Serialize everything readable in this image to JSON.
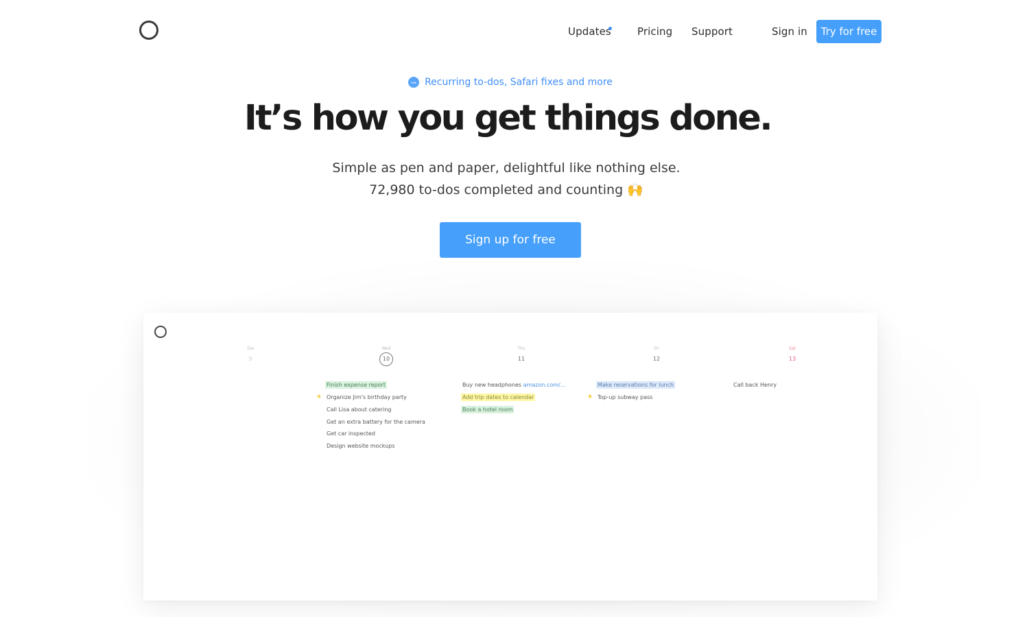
{
  "nav": {
    "updates": "Updates",
    "pricing": "Pricing",
    "support": "Support",
    "sign_in": "Sign in",
    "try_free": "Try for free"
  },
  "hero": {
    "badge": "new",
    "announcement": "Recurring to-dos, Safari fixes and more",
    "headline": "It’s how you get things done.",
    "subline1": "Simple as pen and paper, delightful like nothing else.",
    "subline2": "72,980 to-dos completed and counting",
    "emoji": "🙌",
    "cta": "Sign up for free"
  },
  "preview": {
    "days": [
      {
        "name": "Tue",
        "num": "9"
      },
      {
        "name": "Wed",
        "num": "10"
      },
      {
        "name": "Thu",
        "num": "11"
      },
      {
        "name": "Fri",
        "num": "12"
      },
      {
        "name": "Sat",
        "num": "13"
      }
    ],
    "wed": [
      "Finish expense report",
      "Organize Jim's birthday party",
      "Call Lisa about catering",
      "Get an extra battery for the camera",
      "Get car inspected",
      "Design website mockups"
    ],
    "thu": {
      "item1_text": "Buy new headphones",
      "item1_link": "amazon.com/...",
      "item2": "Add trip dates to calendar",
      "item3": "Book a hotel room"
    },
    "fri": [
      "Make reservations for lunch",
      "Top-up subway pass"
    ],
    "sat": [
      "Call back Henry"
    ]
  },
  "colors": {
    "accent": "#46a0fb",
    "link": "#3f8ef7",
    "weekend": "#e0607a"
  }
}
